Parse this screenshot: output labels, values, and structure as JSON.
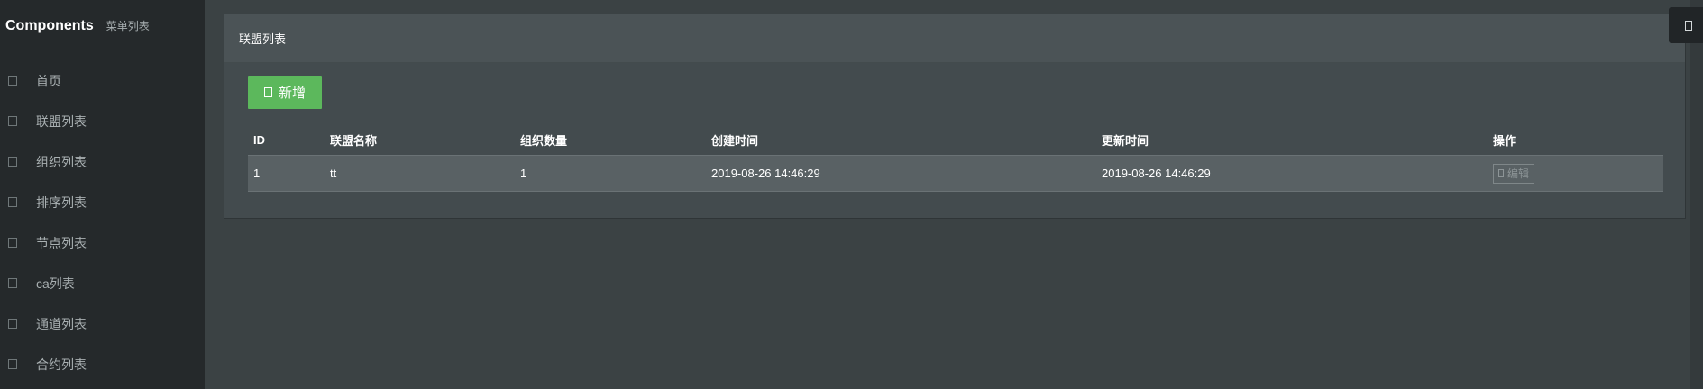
{
  "sidebar": {
    "brand_title": "Components",
    "brand_subtitle": "菜单列表",
    "items": [
      {
        "label": "首页"
      },
      {
        "label": "联盟列表"
      },
      {
        "label": "组织列表"
      },
      {
        "label": "排序列表"
      },
      {
        "label": "节点列表"
      },
      {
        "label": "ca列表"
      },
      {
        "label": "通道列表"
      },
      {
        "label": "合约列表"
      }
    ]
  },
  "panel": {
    "title": "联盟列表",
    "add_button_label": "新增"
  },
  "table": {
    "headers": [
      "ID",
      "联盟名称",
      "组织数量",
      "创建时间",
      "更新时间",
      "操作"
    ],
    "rows": [
      {
        "id": "1",
        "name": "tt",
        "org_count": "1",
        "created": "2019-08-26 14:46:29",
        "updated": "2019-08-26 14:46:29",
        "action": "编辑"
      }
    ]
  },
  "colors": {
    "accent_green": "#5cb85c",
    "sidebar_bg": "#25292b",
    "panel_bg": "#4b5356"
  }
}
